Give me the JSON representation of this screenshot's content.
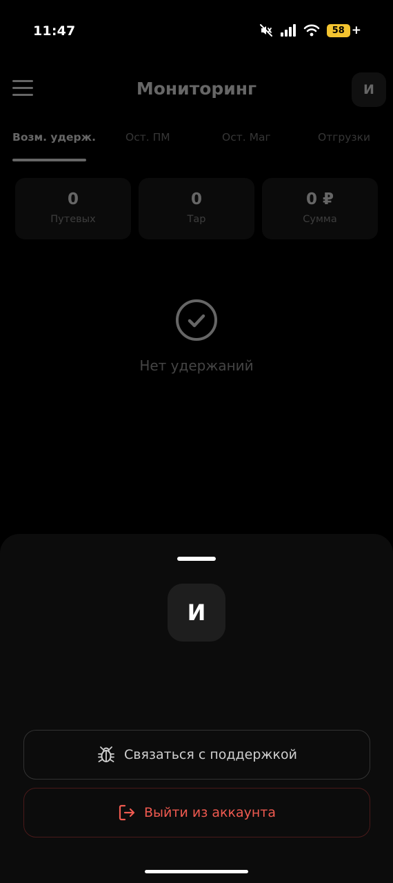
{
  "status_bar": {
    "time": "11:47",
    "battery_level": "58"
  },
  "header": {
    "title": "Мониторинг",
    "avatar_initial": "И"
  },
  "tabs": [
    {
      "label": "Возм. удерж.",
      "active": true
    },
    {
      "label": "Ост. ПМ",
      "active": false
    },
    {
      "label": "Ост. Маг",
      "active": false
    },
    {
      "label": "Отгрузки",
      "active": false
    }
  ],
  "stats": [
    {
      "value": "0",
      "label": "Путевых"
    },
    {
      "value": "0",
      "label": "Тар"
    },
    {
      "value": "0 ₽",
      "label": "Сумма"
    }
  ],
  "empty_state": {
    "text": "Нет удержаний",
    "icon": "check-circle-icon"
  },
  "sheet": {
    "avatar_initial": "И",
    "support_label": "Связаться с поддержкой",
    "support_icon": "bug-icon",
    "logout_label": "Выйти из аккаунта",
    "logout_icon": "logout-icon"
  },
  "colors": {
    "background": "#000000",
    "sheet": "#0c0c0c",
    "card": "#1d1d1d",
    "danger": "#f05a50",
    "battery": "#f4c430"
  }
}
